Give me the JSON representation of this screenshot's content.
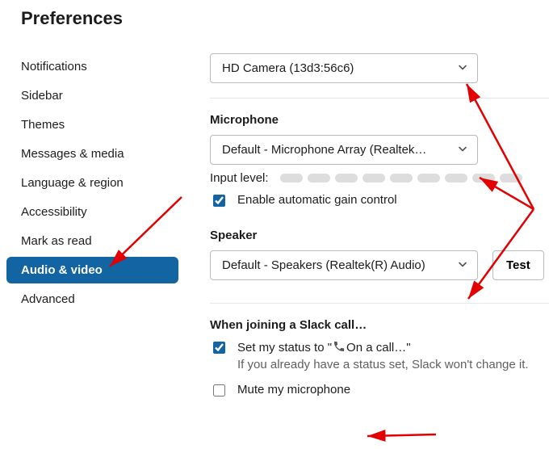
{
  "title": "Preferences",
  "sidebar": {
    "items": [
      {
        "label": "Notifications"
      },
      {
        "label": "Sidebar"
      },
      {
        "label": "Themes"
      },
      {
        "label": "Messages & media"
      },
      {
        "label": "Language & region"
      },
      {
        "label": "Accessibility"
      },
      {
        "label": "Mark as read"
      },
      {
        "label": "Audio & video"
      },
      {
        "label": "Advanced"
      }
    ],
    "active_index": 7
  },
  "camera": {
    "selected": "HD Camera (13d3:56c6)"
  },
  "microphone": {
    "heading": "Microphone",
    "selected": "Default - Microphone Array (Realtek…",
    "input_level_label": "Input level:",
    "gain_label": "Enable automatic gain control",
    "gain_checked": true
  },
  "speaker": {
    "heading": "Speaker",
    "selected": "Default - Speakers (Realtek(R) Audio)",
    "test_label": "Test"
  },
  "joining": {
    "heading": "When joining a Slack call…",
    "status_prefix": "Set my status to \"",
    "status_text": "On a call…\"",
    "status_checked": true,
    "status_note": "If you already have a status set, Slack won't change it.",
    "mute_label": "Mute my microphone",
    "mute_checked": false
  }
}
